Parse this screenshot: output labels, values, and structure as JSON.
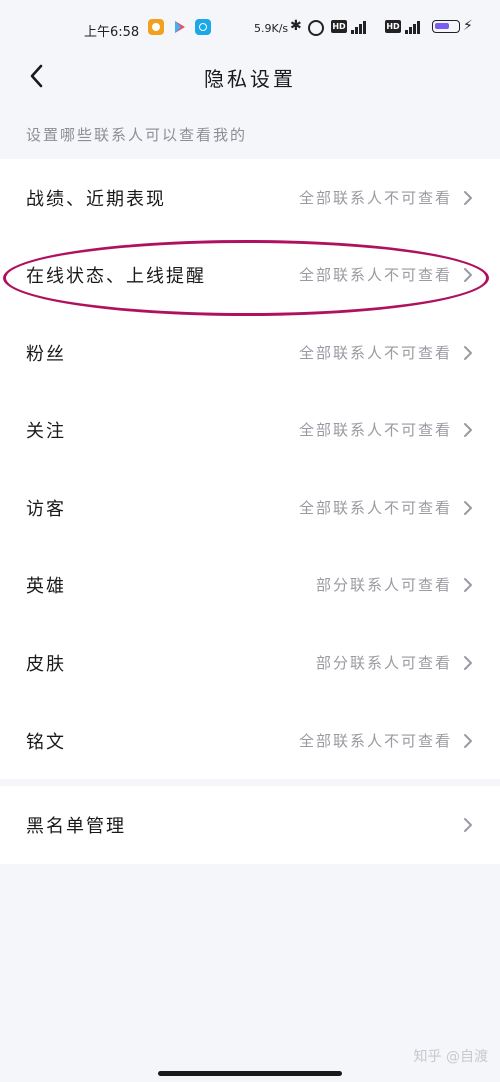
{
  "status_bar": {
    "time": "上午6:58",
    "net_speed": "5.9K/s",
    "bluetooth": "✱",
    "hd_label": "HD",
    "charge": "⚡",
    "icons": [
      "app-icon-orange",
      "play-store-icon",
      "browser-icon",
      "bluetooth-icon",
      "alarm-icon",
      "hd-icon",
      "signal-icon",
      "battery-icon",
      "charging-icon"
    ]
  },
  "header": {
    "title": "隐私设置",
    "back_icon": "chevron-left-icon"
  },
  "section_hint": "设置哪些联系人可以查看我的",
  "privacy_rows": [
    {
      "label": "战绩、近期表现",
      "value": "全部联系人不可查看"
    },
    {
      "label": "在线状态、上线提醒",
      "value": "全部联系人不可查看"
    },
    {
      "label": "粉丝",
      "value": "全部联系人不可查看"
    },
    {
      "label": "关注",
      "value": "全部联系人不可查看"
    },
    {
      "label": "访客",
      "value": "全部联系人不可查看"
    },
    {
      "label": "英雄",
      "value": "部分联系人可查看"
    },
    {
      "label": "皮肤",
      "value": "部分联系人可查看"
    },
    {
      "label": "铭文",
      "value": "全部联系人不可查看"
    }
  ],
  "blacklist": {
    "label": "黑名单管理"
  },
  "watermark": "知乎 @自渡",
  "colors": {
    "background": "#f5f6fa",
    "card": "#ffffff",
    "hint_text": "#8e8e96",
    "value_text": "#9a9aa2",
    "annotation": "#b0115f"
  }
}
